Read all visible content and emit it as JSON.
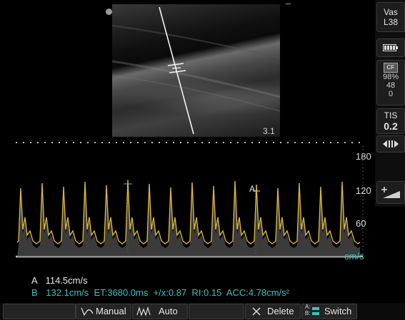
{
  "probe": {
    "line1": "Vas",
    "line2": "L38"
  },
  "color_flow": {
    "label": "CF",
    "gain": "98%",
    "value1": "48",
    "value2": "0"
  },
  "tis": {
    "label": "TIS",
    "value": "0.2"
  },
  "bmode": {
    "depth": "3.1"
  },
  "spectral": {
    "scale": [
      "180",
      "120",
      "60"
    ],
    "unit": "cm/s",
    "cursor_label": "A"
  },
  "measurements": {
    "a_label": "A",
    "a_value": "114.5cm/s",
    "b_label": "B",
    "b_value": "132.1cm/s  ET:3680.0ms  +/x:0.87  RI:0.15  ACC:4.78cm/s²"
  },
  "toolbar": {
    "manual": "Manual",
    "auto": "Auto",
    "delete": "Delete",
    "switch": "Switch",
    "switch_icon_letters": [
      "A:",
      "B:"
    ]
  },
  "colors": {
    "trace": "#d8b53a",
    "accent": "#36c6c2"
  },
  "icons": [
    "battery-icon",
    "arrows-left-right-icon",
    "angle-correction-icon",
    "manual-trace-icon",
    "auto-trace-icon",
    "close-icon",
    "switch-ab-icon"
  ]
}
